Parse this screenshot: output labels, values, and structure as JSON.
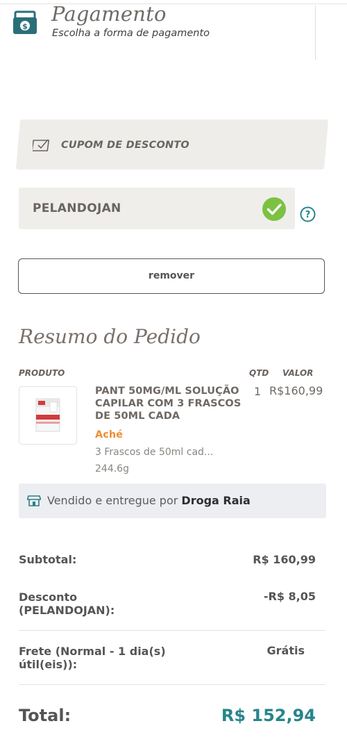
{
  "header": {
    "title": "Pagamento",
    "subtitle": "Escolha a forma de pagamento",
    "icon": "money-bill-icon"
  },
  "coupon": {
    "banner_label": "CUPOM DE DESCONTO",
    "code": "PELANDOJAN",
    "status": "valid",
    "remove_label": "remover"
  },
  "summary": {
    "title": "Resumo do Pedido",
    "columns": {
      "product": "PRODUTO",
      "qty": "QTD",
      "value": "VALOR"
    },
    "items": [
      {
        "name": "PANT 50MG/ML SOLUÇÃO CAPILAR COM 3 FRASCOS DE 50ML CADA",
        "brand": "Aché",
        "detail": "3 Frascos de 50ml cad...",
        "weight": "244.6g",
        "qty": "1",
        "price": "R$160,99"
      }
    ],
    "seller_prefix": "Vendido e entregue por ",
    "seller_name": "Droga Raia"
  },
  "totals": {
    "subtotal_label": "Subtotal:",
    "subtotal_value": "R$ 160,99",
    "discount_label_line1": "Desconto",
    "discount_label_line2": "(PELANDOJAN):",
    "discount_value": "-R$ 8,05",
    "shipping_label_line1": "Frete (Normal - 1 dia(s)",
    "shipping_label_line2": "útil(eis)):",
    "shipping_value": "Grátis",
    "total_label": "Total:",
    "total_value": "R$ 152,94"
  },
  "colors": {
    "accent_teal": "#27858b",
    "brand_orange": "#f08c30",
    "success_green": "#7cc242"
  }
}
